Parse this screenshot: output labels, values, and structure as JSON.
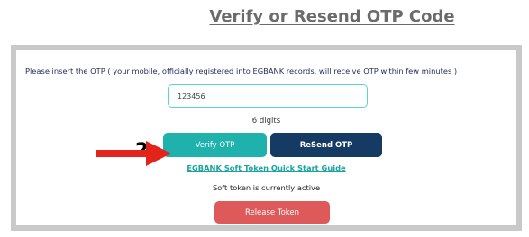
{
  "page_heading": "Verify or Resend OTP Code",
  "form": {
    "instruction": "Please insert the OTP ( your mobile, officially registered into EGBANK records, will receive OTP within few minutes )",
    "otp_value": "123456",
    "digits_hint": "6 digits",
    "verify_label": "Verify OTP",
    "resend_label": "ReSend OTP",
    "guide_link": "EGBANK Soft Token Quick Start Guide",
    "status": "Soft token is currently active",
    "release_label": "Release Token"
  },
  "annotation": {
    "step_number": "2",
    "arrow_icon": "right-arrow-icon",
    "arrow_color": "#e3241b"
  },
  "colors": {
    "verify": "#1fb2ad",
    "resend": "#153a64",
    "release": "#de5a5a",
    "link": "#1aa3a0"
  }
}
